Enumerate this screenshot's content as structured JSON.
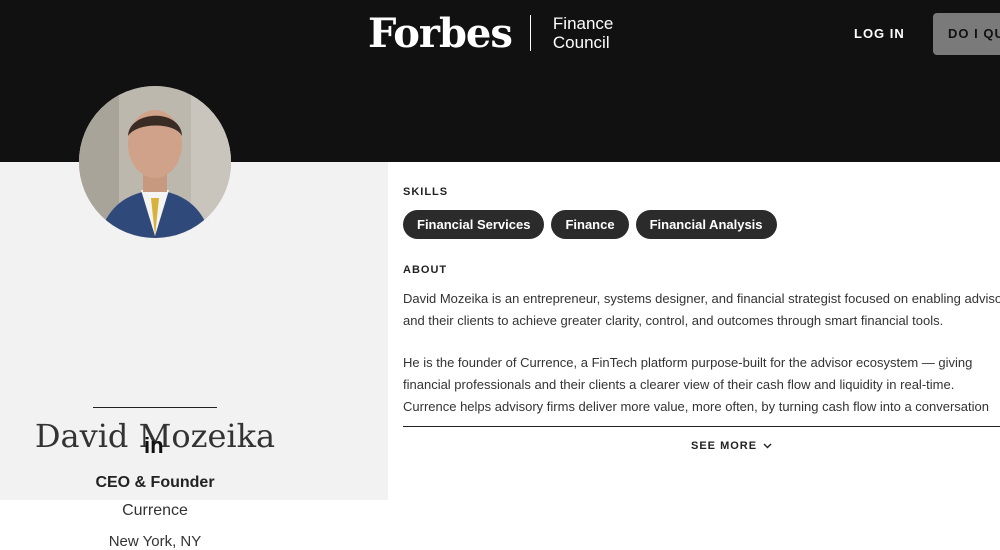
{
  "header": {
    "brand": "Forbes",
    "council_line1": "Finance",
    "council_line2": "Council",
    "login_label": "LOG IN",
    "qualify_label": "DO I QUALIFY?"
  },
  "profile": {
    "name": "David Mozeika",
    "title": "CEO & Founder",
    "company": "Currence",
    "location": "New York, NY",
    "linkedin_label": "in"
  },
  "skills": {
    "heading": "SKILLS",
    "items": [
      "Financial Services",
      "Finance",
      "Financial Analysis"
    ]
  },
  "about": {
    "heading": "ABOUT",
    "paragraph1_line1": "David Mozeika is an entrepreneur, systems designer, and financial strategist focused on enabling advisors",
    "paragraph1_line2": "and their clients to achieve greater clarity, control, and outcomes through smart financial tools.",
    "paragraph2_line1": "He is the founder of Currence, a FinTech platform purpose-built for the advisor ecosystem — giving",
    "paragraph2_line2": "financial professionals and their clients a clearer view of their cash flow and liquidity in real-time.",
    "paragraph2_line3": "Currence helps advisory firms deliver more value, more often, by turning cash flow into a conversation",
    "see_more_label": "SEE MORE"
  },
  "icons": {
    "linkedin": "linkedin-icon",
    "chevron": "chevron-down-icon"
  },
  "colors": {
    "header_bg": "#111111",
    "left_panel_bg": "#f2f2f2",
    "pill_bg": "#2b2b2b",
    "qualify_bg": "#7a7a7a"
  }
}
